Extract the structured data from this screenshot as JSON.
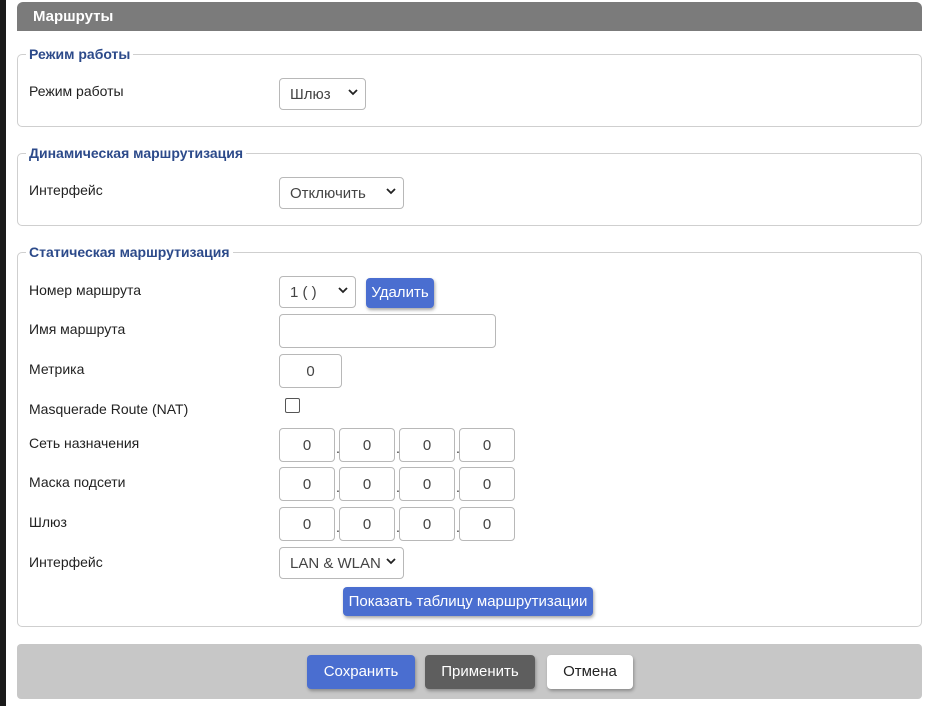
{
  "page": {
    "title": "Маршруты"
  },
  "mode_section": {
    "legend": "Режим работы",
    "mode_label": "Режим работы",
    "mode_value": "Шлюз"
  },
  "dynamic_section": {
    "legend": "Динамическая маршрутизация",
    "interface_label": "Интерфейс",
    "interface_value": "Отключить"
  },
  "static_section": {
    "legend": "Статическая маршрутизация",
    "route_number_label": "Номер маршрута",
    "route_number_value": "1 ( )",
    "delete_button": "Удалить",
    "route_name_label": "Имя маршрута",
    "route_name_value": "",
    "metric_label": "Метрика",
    "metric_value": "0",
    "nat_label": "Masquerade Route (NAT)",
    "nat_checked": false,
    "destination_label": "Сеть назначения",
    "destination": [
      "0",
      "0",
      "0",
      "0"
    ],
    "mask_label": "Маска подсети",
    "mask": [
      "0",
      "0",
      "0",
      "0"
    ],
    "gateway_label": "Шлюз",
    "gateway": [
      "0",
      "0",
      "0",
      "0"
    ],
    "interface_label": "Интерфейс",
    "interface_value": "LAN & WLAN",
    "show_table_button": "Показать таблицу маршрутизации"
  },
  "footer": {
    "save_button": "Сохранить",
    "apply_button": "Применить",
    "cancel_button": "Отмена"
  },
  "colors": {
    "header_bg": "#7b7b7b",
    "legend_text": "#2c4a8a",
    "primary_button": "#4a6ed0",
    "apply_button": "#5e5e5e",
    "footer_bg": "#c7c7c7"
  }
}
